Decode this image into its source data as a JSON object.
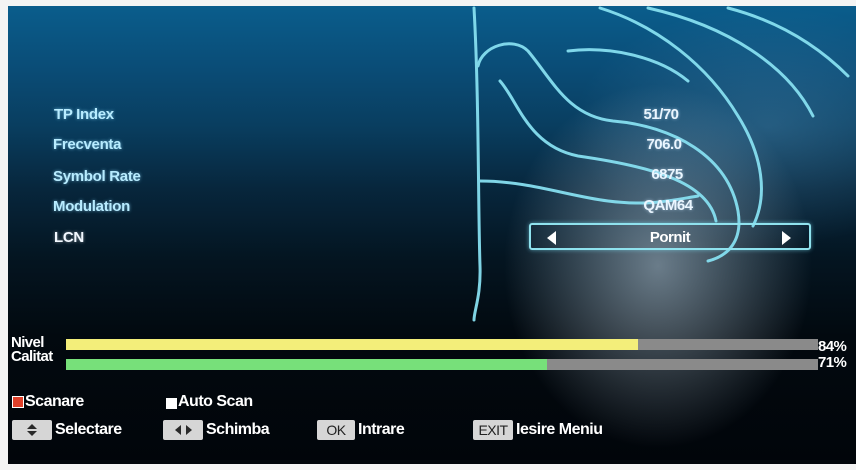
{
  "fields": [
    {
      "label": "TP Index",
      "value": "51/70"
    },
    {
      "label": "Frecventa",
      "value": "706.0"
    },
    {
      "label": "Symbol Rate",
      "value": "6875"
    },
    {
      "label": "Modulation",
      "value": "QAM64"
    }
  ],
  "lcn": {
    "label": "LCN",
    "value": "Pornit"
  },
  "meters": {
    "nivel": {
      "label": "Nivel",
      "percent_text": "84%",
      "level": 0.76,
      "color": "#f3ee7a"
    },
    "calitat": {
      "label": "Calitat",
      "percent_text": "71%",
      "level": 0.64,
      "color": "#77e07a"
    }
  },
  "hints": {
    "scanare": "Scanare",
    "auto_scan": "Auto Scan",
    "selectare": "Selectare",
    "schimba": "Schimba",
    "ok_key": "OK",
    "intrare": "Intrare",
    "exit_key": "EXIT",
    "iesire_meniu": "Iesire Meniu"
  },
  "icons": [
    "arrow-left-icon",
    "arrow-right-icon",
    "red-key-icon",
    "white-key-icon",
    "up-down-icon",
    "left-right-icon"
  ],
  "colors": {
    "accent_cyan": "#8fe2ee",
    "label_cyan": "#b8ecff",
    "red_key": "#e0402a"
  }
}
